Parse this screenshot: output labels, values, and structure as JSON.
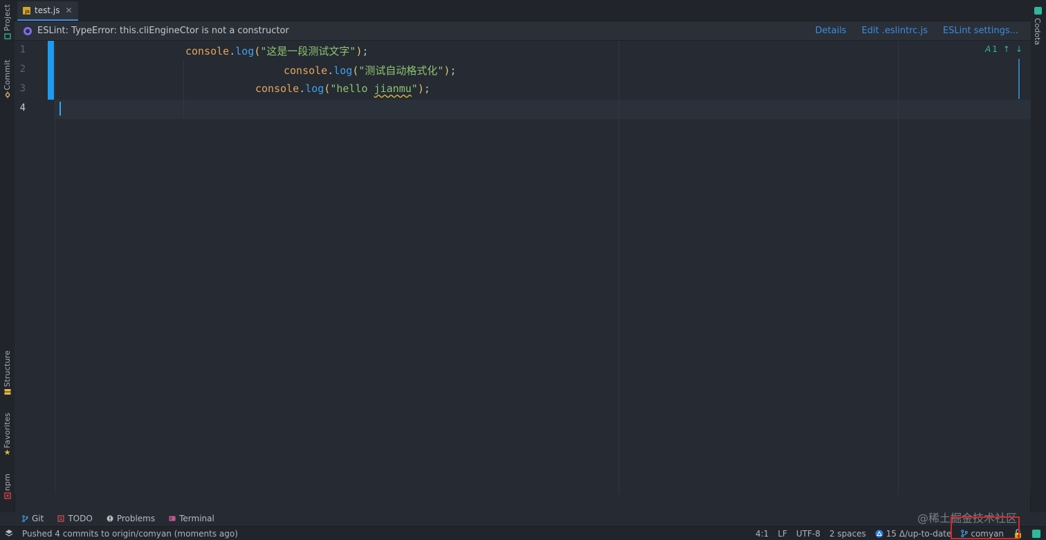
{
  "tabs": [
    {
      "label": "test.js",
      "badge": "JS"
    }
  ],
  "banner": {
    "message": "ESLint: TypeError: this.cliEngineCtor is not a constructor",
    "links": [
      "Details",
      "Edit .eslintrc.js",
      "ESLint settings..."
    ]
  },
  "left_tools": [
    "Project",
    "Commit",
    "Structure",
    "Favorites",
    "npm"
  ],
  "right_tools": [
    "Codota"
  ],
  "editor": {
    "line_numbers": [
      "1",
      "2",
      "3",
      "4"
    ],
    "lines": [
      {
        "obj": "console",
        "dot": ".",
        "fn": "log",
        "open": "(",
        "str": "\"这是一段测试文字\"",
        "close": ")",
        "semi": ";"
      },
      {
        "obj": "console",
        "dot": ".",
        "fn": "log",
        "open": "(",
        "str": "\"测试自动格式化\"",
        "close": ")",
        "semi": ";"
      },
      {
        "obj": "console",
        "dot": ".",
        "fn": "log",
        "open": "(",
        "str_pre": "\"hello ",
        "str_squig": "jianmu",
        "str_post": "\"",
        "close": ")",
        "semi": ";"
      }
    ],
    "inspections": {
      "count": "1"
    }
  },
  "bottom_tools": [
    "Git",
    "TODO",
    "Problems",
    "Terminal"
  ],
  "status": {
    "message": "Pushed 4 commits to origin/comyan (moments ago)",
    "position": "4:1",
    "line_sep": "LF",
    "encoding": "UTF-8",
    "indent": "2 spaces",
    "vcs": "15 Δ/up-to-date",
    "branch": "comyan"
  },
  "watermark": "@稀土掘金技术社区",
  "colors": {
    "accent": "#3d8de0",
    "changebar": "#1d9bf0",
    "string": "#8fc46e",
    "object": "#e5a65a",
    "function": "#3fa3e8"
  }
}
